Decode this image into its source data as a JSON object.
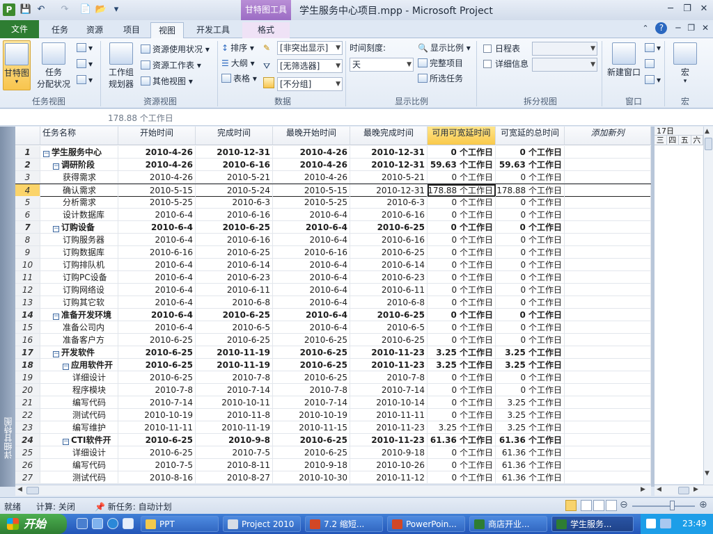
{
  "window": {
    "title": "学生服务中心项目.mpp  -  Microsoft Project",
    "contextual_tab_group": "甘特图工具",
    "minimize": "─",
    "restore": "❐",
    "close": "✕"
  },
  "qat": {
    "save_icon": "💾",
    "undo_icon": "↶",
    "redo_icon": "↷",
    "new_icon": "📄",
    "open_icon": "📂",
    "customize_icon": "▾"
  },
  "tabs": [
    {
      "label": "文件"
    },
    {
      "label": "任务"
    },
    {
      "label": "资源"
    },
    {
      "label": "项目"
    },
    {
      "label": "视图"
    },
    {
      "label": "开发工具"
    },
    {
      "label": "格式"
    }
  ],
  "ribbon": {
    "task_views": {
      "gantt": "甘特图",
      "task_usage_1": "任务",
      "task_usage_2": "分配状况",
      "group_label": "任务视图"
    },
    "resource_views": {
      "team_planner_1": "工作组",
      "team_planner_2": "规划器",
      "resource_usage": "资源使用状况",
      "resource_sheet": "资源工作表",
      "other_views": "其他视图",
      "group_label": "资源视图"
    },
    "data": {
      "sort": "排序",
      "outline": "大纲",
      "tables": "表格",
      "highlight_value": "[非突出显示]",
      "filter_value": "[无筛选器]",
      "group_value": "[不分组]",
      "group_label": "数据"
    },
    "zoom": {
      "timescale_label": "时间刻度:",
      "timescale_value": "天",
      "zoom": "显示比例",
      "entire_project": "完整项目",
      "selected_tasks": "所选任务",
      "group_label": "显示比例"
    },
    "split_view": {
      "timeline": "日程表",
      "details": "详细信息",
      "group_label": "拆分视图"
    },
    "window": {
      "new_window": "新建窗口",
      "group_label": "窗口"
    },
    "macros": {
      "macros": "宏",
      "group_label": "宏"
    }
  },
  "entry_bar": {
    "value": "178.88 个工作日"
  },
  "view_bar": {
    "label": "详细甘特图"
  },
  "columns": [
    {
      "label": "任务名称"
    },
    {
      "label": "开始时间"
    },
    {
      "label": "完成时间"
    },
    {
      "label": "最晚开始时间"
    },
    {
      "label": "最晚完成时间"
    },
    {
      "label": "可用可宽延时间"
    },
    {
      "label": "可宽延的总时间"
    },
    {
      "label": "添加新列"
    }
  ],
  "tasks": [
    {
      "id": "1",
      "name": "学生服务中心",
      "start": "2010-4-26",
      "finish": "2010-12-31",
      "late_start": "2010-4-26",
      "late_finish": "2010-12-31",
      "free_slack": "0 个工作日",
      "total_slack": "0 个工作日"
    },
    {
      "id": "2",
      "name": "调研阶段",
      "start": "2010-4-26",
      "finish": "2010-6-16",
      "late_start": "2010-4-26",
      "late_finish": "2010-12-31",
      "free_slack": "59.63 个工作日",
      "total_slack": "59.63 个工作日"
    },
    {
      "id": "3",
      "name": "获得需求",
      "start": "2010-4-26",
      "finish": "2010-5-21",
      "late_start": "2010-4-26",
      "late_finish": "2010-5-21",
      "free_slack": "0 个工作日",
      "total_slack": "0 个工作日"
    },
    {
      "id": "4",
      "name": "确认需求",
      "start": "2010-5-15",
      "finish": "2010-5-24",
      "late_start": "2010-5-15",
      "late_finish": "2010-12-31",
      "free_slack": "178.88 个工作日",
      "total_slack": "178.88 个工作日"
    },
    {
      "id": "5",
      "name": "分析需求",
      "start": "2010-5-25",
      "finish": "2010-6-3",
      "late_start": "2010-5-25",
      "late_finish": "2010-6-3",
      "free_slack": "0 个工作日",
      "total_slack": "0 个工作日"
    },
    {
      "id": "6",
      "name": "设计数据库",
      "start": "2010-6-4",
      "finish": "2010-6-16",
      "late_start": "2010-6-4",
      "late_finish": "2010-6-16",
      "free_slack": "0 个工作日",
      "total_slack": "0 个工作日"
    },
    {
      "id": "7",
      "name": "订购设备",
      "start": "2010-6-4",
      "finish": "2010-6-25",
      "late_start": "2010-6-4",
      "late_finish": "2010-6-25",
      "free_slack": "0 个工作日",
      "total_slack": "0 个工作日"
    },
    {
      "id": "8",
      "name": "订购服务器",
      "start": "2010-6-4",
      "finish": "2010-6-16",
      "late_start": "2010-6-4",
      "late_finish": "2010-6-16",
      "free_slack": "0 个工作日",
      "total_slack": "0 个工作日"
    },
    {
      "id": "9",
      "name": "订购数据库",
      "start": "2010-6-16",
      "finish": "2010-6-25",
      "late_start": "2010-6-16",
      "late_finish": "2010-6-25",
      "free_slack": "0 个工作日",
      "total_slack": "0 个工作日"
    },
    {
      "id": "10",
      "name": "订购排队机",
      "start": "2010-6-4",
      "finish": "2010-6-14",
      "late_start": "2010-6-4",
      "late_finish": "2010-6-14",
      "free_slack": "0 个工作日",
      "total_slack": "0 个工作日"
    },
    {
      "id": "11",
      "name": "订购PC设备",
      "start": "2010-6-4",
      "finish": "2010-6-23",
      "late_start": "2010-6-4",
      "late_finish": "2010-6-23",
      "free_slack": "0 个工作日",
      "total_slack": "0 个工作日"
    },
    {
      "id": "12",
      "name": "订购网络设",
      "start": "2010-6-4",
      "finish": "2010-6-11",
      "late_start": "2010-6-4",
      "late_finish": "2010-6-11",
      "free_slack": "0 个工作日",
      "total_slack": "0 个工作日"
    },
    {
      "id": "13",
      "name": "订购其它软",
      "start": "2010-6-4",
      "finish": "2010-6-8",
      "late_start": "2010-6-4",
      "late_finish": "2010-6-8",
      "free_slack": "0 个工作日",
      "total_slack": "0 个工作日"
    },
    {
      "id": "14",
      "name": "准备开发环境",
      "start": "2010-6-4",
      "finish": "2010-6-25",
      "late_start": "2010-6-4",
      "late_finish": "2010-6-25",
      "free_slack": "0 个工作日",
      "total_slack": "0 个工作日"
    },
    {
      "id": "15",
      "name": "准备公司内",
      "start": "2010-6-4",
      "finish": "2010-6-5",
      "late_start": "2010-6-4",
      "late_finish": "2010-6-5",
      "free_slack": "0 个工作日",
      "total_slack": "0 个工作日"
    },
    {
      "id": "16",
      "name": "准备客户方",
      "start": "2010-6-25",
      "finish": "2010-6-25",
      "late_start": "2010-6-25",
      "late_finish": "2010-6-25",
      "free_slack": "0 个工作日",
      "total_slack": "0 个工作日"
    },
    {
      "id": "17",
      "name": "开发软件",
      "start": "2010-6-25",
      "finish": "2010-11-19",
      "late_start": "2010-6-25",
      "late_finish": "2010-11-23",
      "free_slack": "3.25 个工作日",
      "total_slack": "3.25 个工作日"
    },
    {
      "id": "18",
      "name": "应用软件开",
      "start": "2010-6-25",
      "finish": "2010-11-19",
      "late_start": "2010-6-25",
      "late_finish": "2010-11-23",
      "free_slack": "3.25 个工作日",
      "total_slack": "3.25 个工作日"
    },
    {
      "id": "19",
      "name": "详细设计",
      "start": "2010-6-25",
      "finish": "2010-7-8",
      "late_start": "2010-6-25",
      "late_finish": "2010-7-8",
      "free_slack": "0 个工作日",
      "total_slack": "0 个工作日"
    },
    {
      "id": "20",
      "name": "程序模块",
      "start": "2010-7-8",
      "finish": "2010-7-14",
      "late_start": "2010-7-8",
      "late_finish": "2010-7-14",
      "free_slack": "0 个工作日",
      "total_slack": "0 个工作日"
    },
    {
      "id": "21",
      "name": "编写代码",
      "start": "2010-7-14",
      "finish": "2010-10-11",
      "late_start": "2010-7-14",
      "late_finish": "2010-10-14",
      "free_slack": "0 个工作日",
      "total_slack": "3.25 个工作日"
    },
    {
      "id": "22",
      "name": "测试代码",
      "start": "2010-10-19",
      "finish": "2010-11-8",
      "late_start": "2010-10-19",
      "late_finish": "2010-11-11",
      "free_slack": "0 个工作日",
      "total_slack": "3.25 个工作日"
    },
    {
      "id": "23",
      "name": "编写维护",
      "start": "2010-11-11",
      "finish": "2010-11-19",
      "late_start": "2010-11-15",
      "late_finish": "2010-11-23",
      "free_slack": "3.25 个工作日",
      "total_slack": "3.25 个工作日"
    },
    {
      "id": "24",
      "name": "CTI软件开",
      "start": "2010-6-25",
      "finish": "2010-9-8",
      "late_start": "2010-6-25",
      "late_finish": "2010-11-23",
      "free_slack": "61.36 个工作日",
      "total_slack": "61.36 个工作日"
    },
    {
      "id": "25",
      "name": "详细设计",
      "start": "2010-6-25",
      "finish": "2010-7-5",
      "late_start": "2010-6-25",
      "late_finish": "2010-9-18",
      "free_slack": "0 个工作日",
      "total_slack": "61.36 个工作日"
    },
    {
      "id": "26",
      "name": "编写代码",
      "start": "2010-7-5",
      "finish": "2010-8-11",
      "late_start": "2010-9-18",
      "late_finish": "2010-10-26",
      "free_slack": "0 个工作日",
      "total_slack": "61.36 个工作日"
    },
    {
      "id": "27",
      "name": "测试代码",
      "start": "2010-8-16",
      "finish": "2010-8-27",
      "late_start": "2010-10-30",
      "late_finish": "2010-11-12",
      "free_slack": "0 个工作日",
      "total_slack": "61.36 个工作日"
    }
  ],
  "gantt": {
    "date_label": "17日",
    "days": [
      "三",
      "四",
      "五",
      "六"
    ]
  },
  "status": {
    "ready": "就绪",
    "calc": "计算: 关闭",
    "new_tasks": "新任务: 自动计划"
  },
  "taskbar": {
    "start": "开始",
    "items": [
      {
        "label": "PPT",
        "color": "#f2c94c"
      },
      {
        "label": "Project 2010",
        "color": "#d7dde6"
      },
      {
        "label": "7.2 缩短...",
        "color": "#d24726"
      },
      {
        "label": "PowerPoin...",
        "color": "#d24726"
      },
      {
        "label": "商店开业...",
        "color": "#2e7d32"
      },
      {
        "label": "学生服务...",
        "color": "#2e7d32"
      }
    ],
    "clock": "23:49"
  },
  "colors": {
    "accent_green": "#2e7d32",
    "selection_yellow": "#f9c94a",
    "ribbon_blue": "#dfe8f4"
  }
}
